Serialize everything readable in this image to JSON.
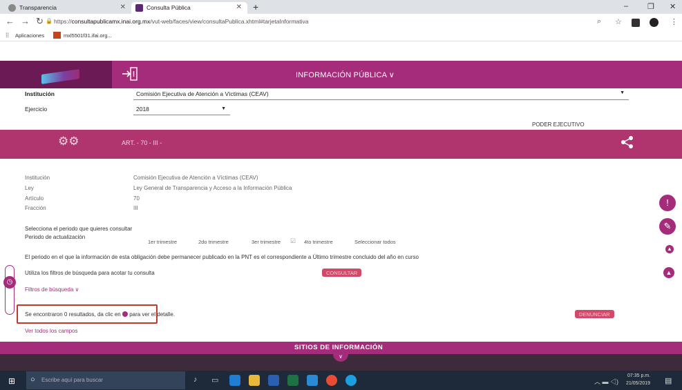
{
  "browser": {
    "tabs": [
      {
        "label": "Transparencia",
        "active": false
      },
      {
        "label": "Consulta Pública",
        "active": true
      }
    ],
    "url_prefix": "https://",
    "url_host": "consultapublicamx.inai.org.mx",
    "url_path": "/vut-web/faces/view/consultaPublica.xhtml#tarjetaInformativa",
    "bookmarks": [
      {
        "label": "Aplicaciones"
      },
      {
        "label": "mxl5501f31.ifai.org..."
      }
    ]
  },
  "header": {
    "menu_title": "INFORMACIÓN PÚBLICA ∨"
  },
  "filters": {
    "institucion_label": "Institución",
    "institucion_value": "Comisión Ejecutiva de Atención a Víctimas (CEAV)",
    "ejercicio_label": "Ejercicio",
    "ejercicio_value": "2018",
    "poder": "PODER EJECUTIVO"
  },
  "article": {
    "title": "ART. - 70 - III -"
  },
  "info": {
    "rows": [
      {
        "label": "Institución",
        "value": "Comisión Ejecutiva de Atención a Víctimas (CEAV)"
      },
      {
        "label": "Ley",
        "value": "Ley General de Transparencia y Acceso a la Información Pública"
      },
      {
        "label": "Artículo",
        "value": "70"
      },
      {
        "label": "Fracción",
        "value": "III"
      }
    ]
  },
  "periodo": {
    "prompt": "Selecciona el periodo que quieres consultar",
    "label": "Periodo de actualización",
    "options": [
      "1er trimestre",
      "2do trimestre",
      "3er trimestre",
      "4to trimestre",
      "Seleccionar todos"
    ]
  },
  "notice": "El periodo en el que la información de esta obligación debe permanecer publicado en la PNT es el correspondiente a Último trimestre concluido del año en curso",
  "filters_hint": "Utiliza los filtros de búsqueda para acotar tu consulta",
  "consultar_label": "CONSULTAR",
  "filtros_label": "Filtros de búsqueda ∨",
  "results": {
    "prefix": "Se encontraron 0 resultados, da clic en",
    "suffix": "para ver el detalle."
  },
  "denunciar_label": "DENUNCIAR",
  "ver_todos_label": "Ver todos los campos",
  "footer": {
    "title": "SITIOS DE INFORMACIÓN"
  },
  "taskbar": {
    "search_placeholder": "Escribe aquí para buscar",
    "time": "07:35 p.m.",
    "date": "21/05/2019"
  },
  "colors": {
    "brand": "#a52b7b",
    "article_bar": "#b0356e",
    "highlight_box": "#c0392b"
  }
}
